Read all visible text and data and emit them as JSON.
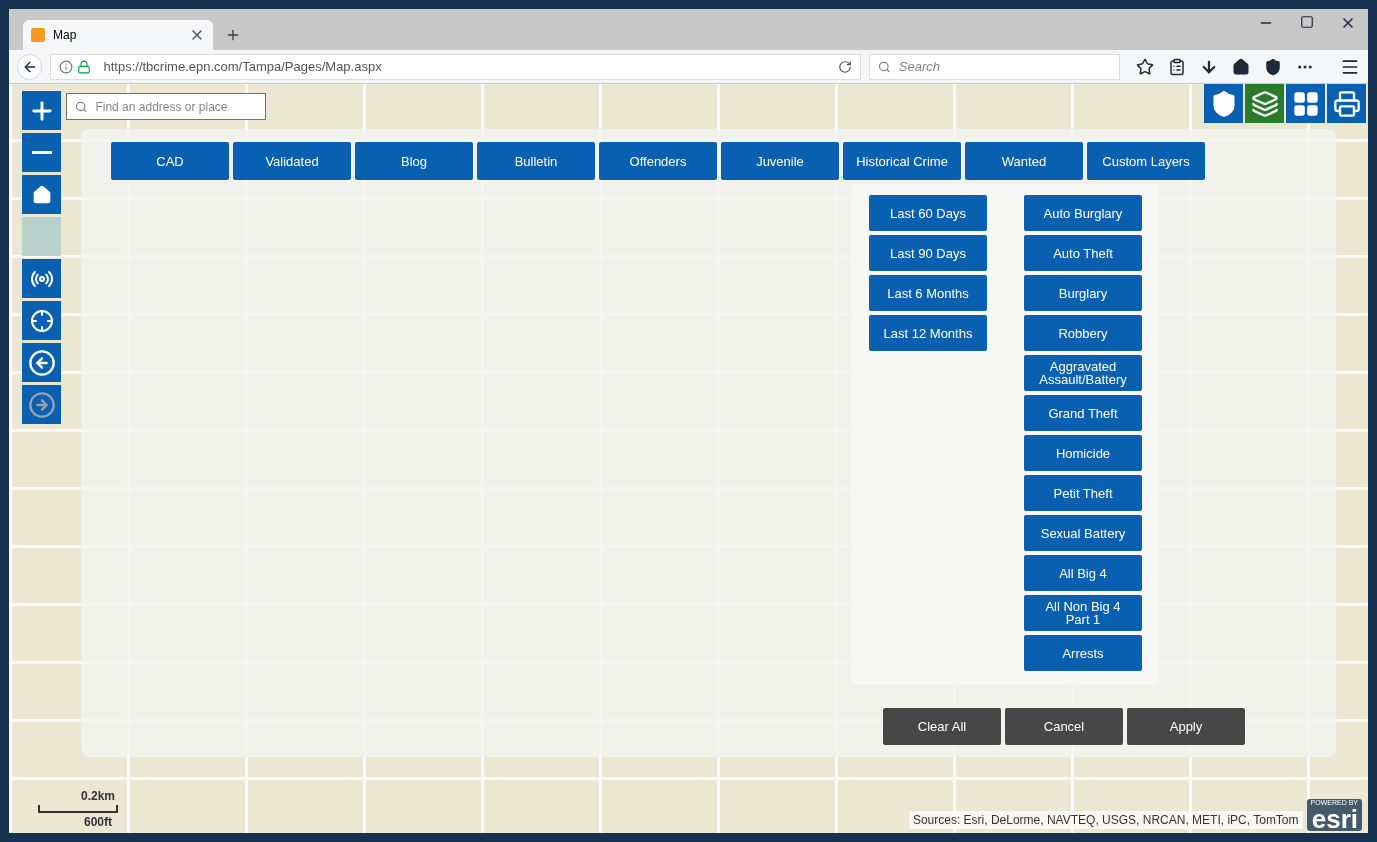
{
  "browser": {
    "tab": {
      "title": "Map"
    },
    "url": "https://tbcrime.epn.com/Tampa/Pages/Map.aspx",
    "search": {
      "placeholder": "Search"
    }
  },
  "map": {
    "search": {
      "placeholder": "Find an address or place"
    },
    "tools": [
      {
        "kind": "zoom-in",
        "disabled": false
      },
      {
        "kind": "zoom-out",
        "disabled": false
      },
      {
        "kind": "home",
        "disabled": false
      },
      {
        "kind": "basemap",
        "disabled": false
      },
      {
        "kind": "locate",
        "disabled": false
      },
      {
        "kind": "crosshair",
        "disabled": false
      },
      {
        "kind": "back",
        "disabled": false
      },
      {
        "kind": "forward",
        "disabled": true
      }
    ],
    "widgets": [
      {
        "kind": "badge",
        "selected": false
      },
      {
        "kind": "layers",
        "selected": true
      },
      {
        "kind": "grid",
        "selected": false
      },
      {
        "kind": "print",
        "selected": false
      }
    ],
    "tabs": [
      "CAD",
      "Validated",
      "Blog",
      "Bulletin",
      "Offenders",
      "Juvenile",
      "Historical Crime",
      "Wanted",
      "Custom Layers"
    ],
    "time_ranges": [
      "Last 60 Days",
      "Last 90 Days",
      "Last 6 Months",
      "Last 12 Months"
    ],
    "crime_types": [
      "Auto Burglary",
      "Auto Theft",
      "Burglary",
      "Robbery",
      "Aggravated Assault/Battery",
      "Grand Theft",
      "Homicide",
      "Petit Theft",
      "Sexual Battery",
      "All Big 4",
      "All Non Big 4 Part 1",
      "Arrests"
    ],
    "actions": [
      "Clear All",
      "Cancel",
      "Apply"
    ],
    "scale": {
      "metric": "0.2km",
      "imperial": "600ft"
    },
    "attribution": "Sources: Esri, DeLorme, NAVTEQ, USGS, NRCAN, METI, iPC, TomTom",
    "logo": {
      "caption": "POWERED BY",
      "name": "esri"
    }
  }
}
